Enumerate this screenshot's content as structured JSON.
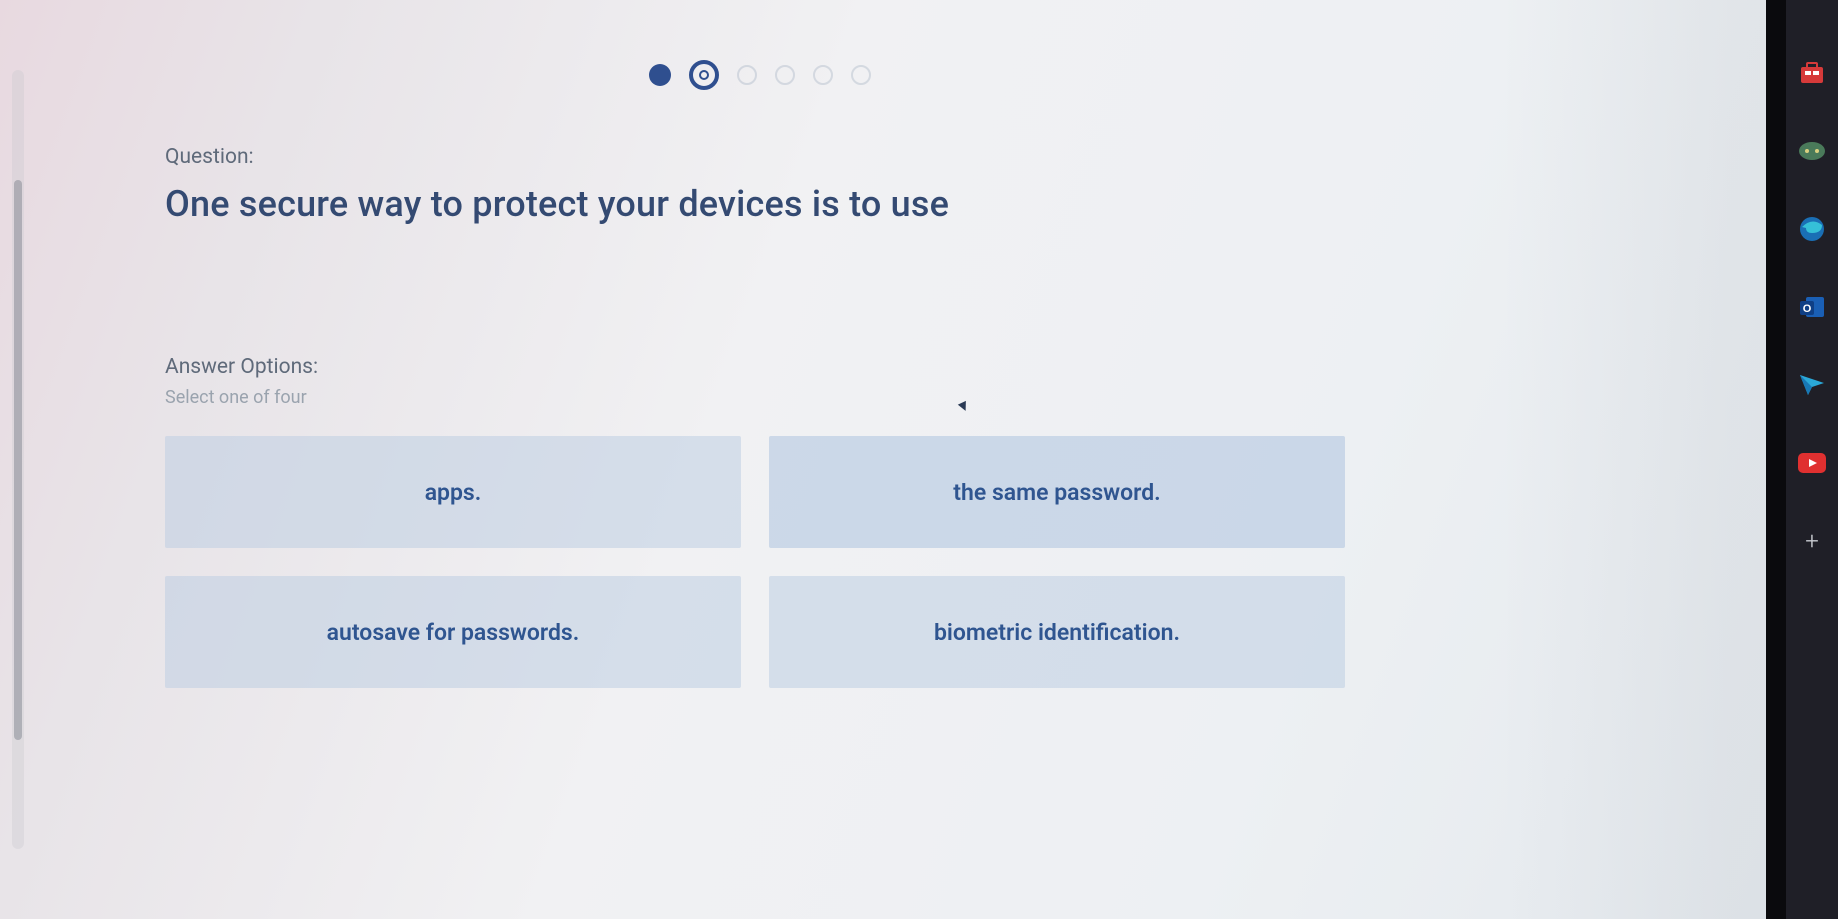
{
  "pager": {
    "total": 6,
    "completed_index": 0,
    "current_index": 1
  },
  "question": {
    "label": "Question:",
    "text": "One secure way to protect your devices is to use"
  },
  "answers": {
    "label": "Answer Options:",
    "hint": "Select one of four",
    "options": [
      "apps.",
      "the same password.",
      "autosave for passwords.",
      "biometric identification."
    ]
  },
  "taskbar": {
    "items": [
      "store",
      "game",
      "edge",
      "outlook",
      "send",
      "youtube",
      "add"
    ]
  }
}
